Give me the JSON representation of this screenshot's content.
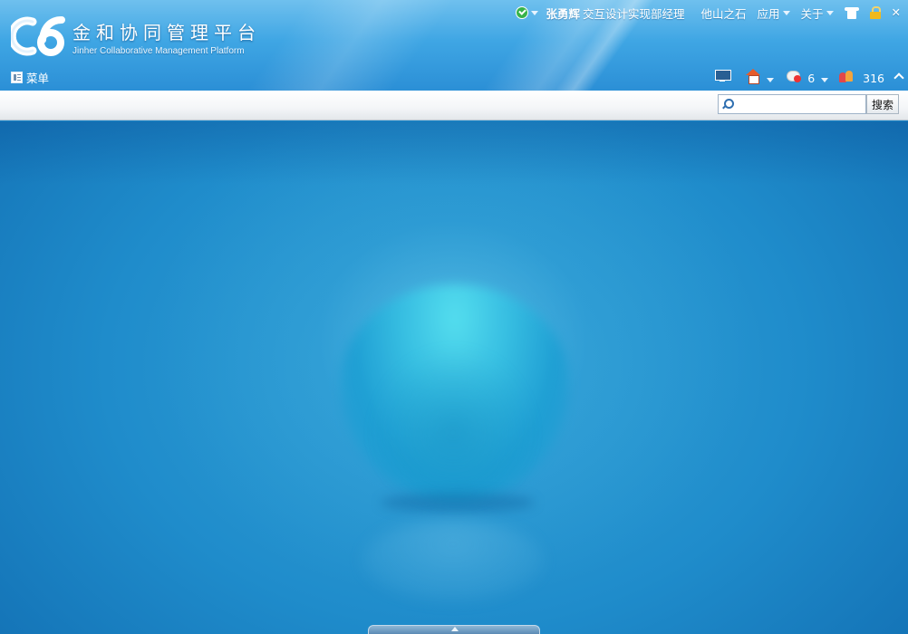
{
  "header": {
    "logo_mark": "C6",
    "title_cn": "金和协同管理平台",
    "title_en": "Jinher Collaborative Management Platform"
  },
  "topbar": {
    "user_name": "张勇辉",
    "user_role": "交互设计实现部经理",
    "link_1": "他山之石",
    "apps_label": "应用",
    "about_label": "关于"
  },
  "toolbar": {
    "menu_label": "菜单",
    "messages_count": "6",
    "online_users_count": "316"
  },
  "search": {
    "placeholder": "",
    "button_label": "搜索"
  },
  "icons": [
    "status-online-icon",
    "skin-shirt-icon",
    "lock-icon",
    "close-icon",
    "menu-icon",
    "monitor-icon",
    "home-icon",
    "message-icon",
    "users-icon",
    "collapse-up-icon",
    "search-icon"
  ]
}
